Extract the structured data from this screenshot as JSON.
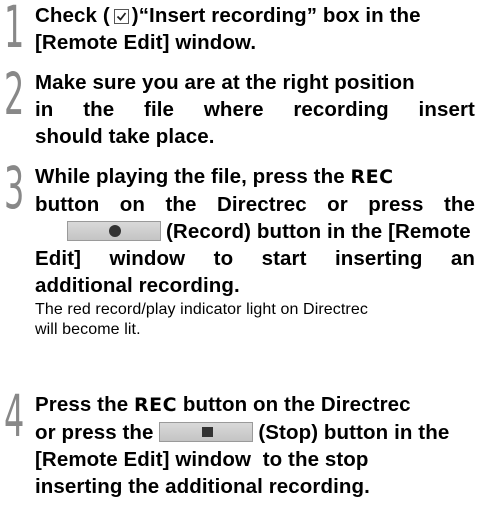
{
  "steps": [
    {
      "number": "1",
      "lines": [
        {
          "before": "Check (",
          "after": ")“Insert recording” box in the"
        },
        "[Remote Edit] window."
      ]
    },
    {
      "number": "2",
      "lines": [
        "Make sure you are at the right position",
        "in the file where recording insert",
        "should take place."
      ]
    },
    {
      "number": "3",
      "lines": [
        {
          "before": "While playing the file, press the ",
          "keyword": "REC"
        },
        "button on the Directrec or press the",
        {
          "after": "(Record) button in the [Remote"
        },
        "Edit] window to start inserting an",
        "additional recording."
      ],
      "note": [
        "The red record/play indicator light on Directrec",
        "will become lit."
      ]
    },
    {
      "number": "4",
      "lines": [
        {
          "before": "Press the ",
          "keyword": "REC",
          "after": " button on the Directrec"
        },
        {
          "before": "or press the ",
          "after": "(Stop) button in the"
        },
        "[Remote Edit] window  to the stop",
        "inserting the additional recording."
      ]
    }
  ],
  "icons": {
    "checkbox": "checkbox-checked-icon",
    "record_button": "record-button-icon",
    "stop_button": "stop-button-icon"
  }
}
